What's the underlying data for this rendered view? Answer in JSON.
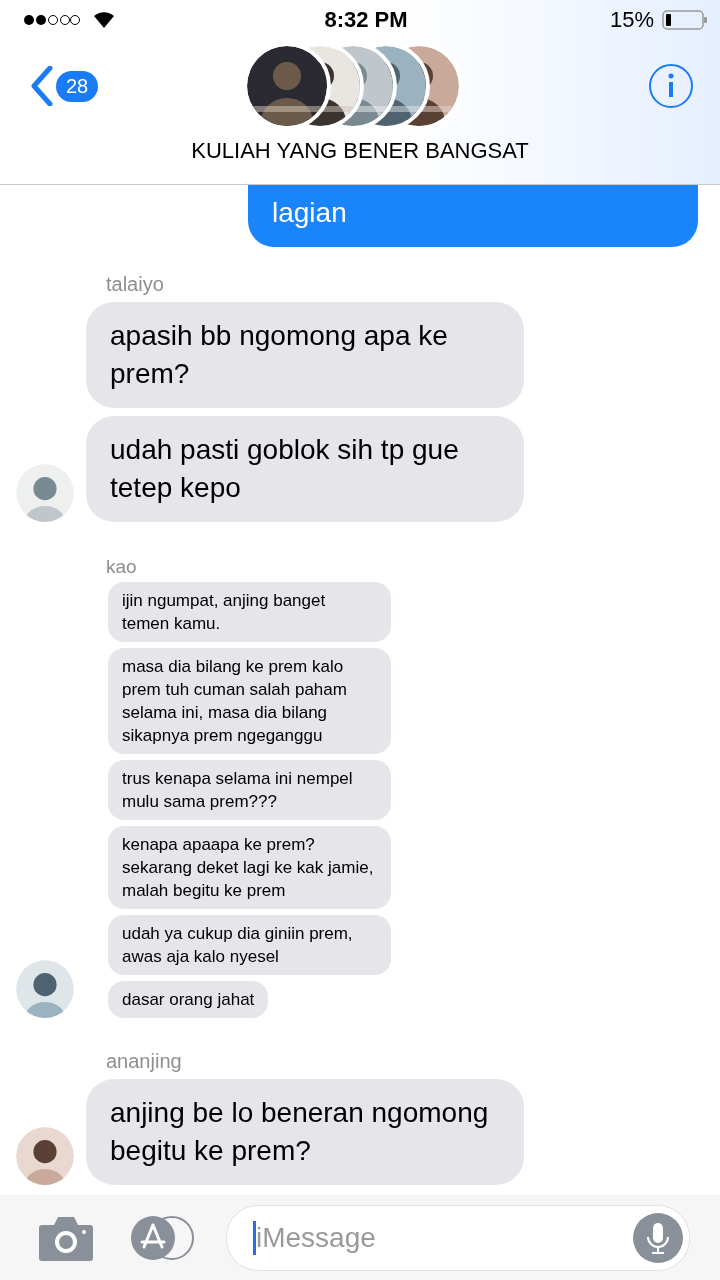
{
  "status_bar": {
    "time": "8:32 PM",
    "battery": "15%"
  },
  "header": {
    "back_count": "28",
    "title": "KULIAH YANG BENER BANGSAT"
  },
  "messages": [
    {
      "kind": "outgoing",
      "bubbles": [
        "lagian"
      ]
    },
    {
      "kind": "large",
      "sender": "talaiyo",
      "bubbles": [
        "apasih bb ngomong apa ke prem?",
        "udah pasti goblok sih tp gue tetep kepo"
      ]
    },
    {
      "kind": "small",
      "sender": "kao",
      "bubbles": [
        "ijin ngumpat, anjing banget temen kamu.",
        "masa dia bilang ke prem kalo prem tuh cuman salah paham selama ini, masa dia bilang sikapnya prem ngeganggu",
        "trus kenapa selama ini nempel mulu sama prem???",
        "kenapa apaapa ke prem? sekarang deket lagi ke kak jamie, malah begitu ke prem",
        "udah ya cukup dia giniin prem, awas aja kalo nyesel",
        "dasar orang jahat"
      ]
    },
    {
      "kind": "large",
      "sender": "ananjing",
      "bubbles": [
        "anjing be lo beneran ngomong begitu ke prem?"
      ]
    }
  ],
  "composer": {
    "placeholder": "iMessage"
  }
}
